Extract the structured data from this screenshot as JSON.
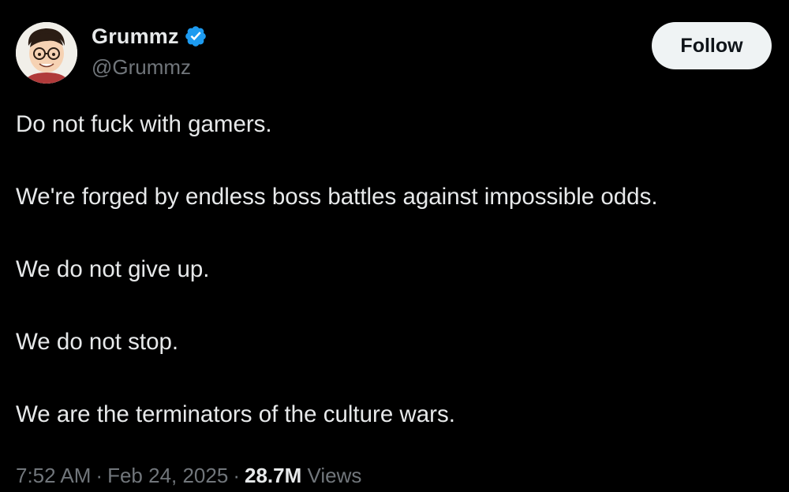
{
  "author": {
    "display_name": "Grummz",
    "handle": "@Grummz",
    "verified": true
  },
  "follow_button": {
    "label": "Follow"
  },
  "tweet": {
    "lines": [
      "Do not fuck with gamers.",
      "We're forged by endless boss battles against impossible odds.",
      "We do not give up.",
      "We do not stop.",
      "We are the terminators of the culture wars."
    ]
  },
  "meta": {
    "time": "7:52 AM",
    "separator": "·",
    "date": "Feb 24, 2025",
    "views_count": "28.7M",
    "views_label": "Views"
  },
  "icons": {
    "verified": "verified-badge-icon",
    "avatar": "cartoon-avatar"
  },
  "colors": {
    "background": "#000000",
    "text_primary": "#e7e9ea",
    "text_secondary": "#71767b",
    "verified_blue": "#1d9bf0",
    "follow_bg": "#eff3f4"
  }
}
